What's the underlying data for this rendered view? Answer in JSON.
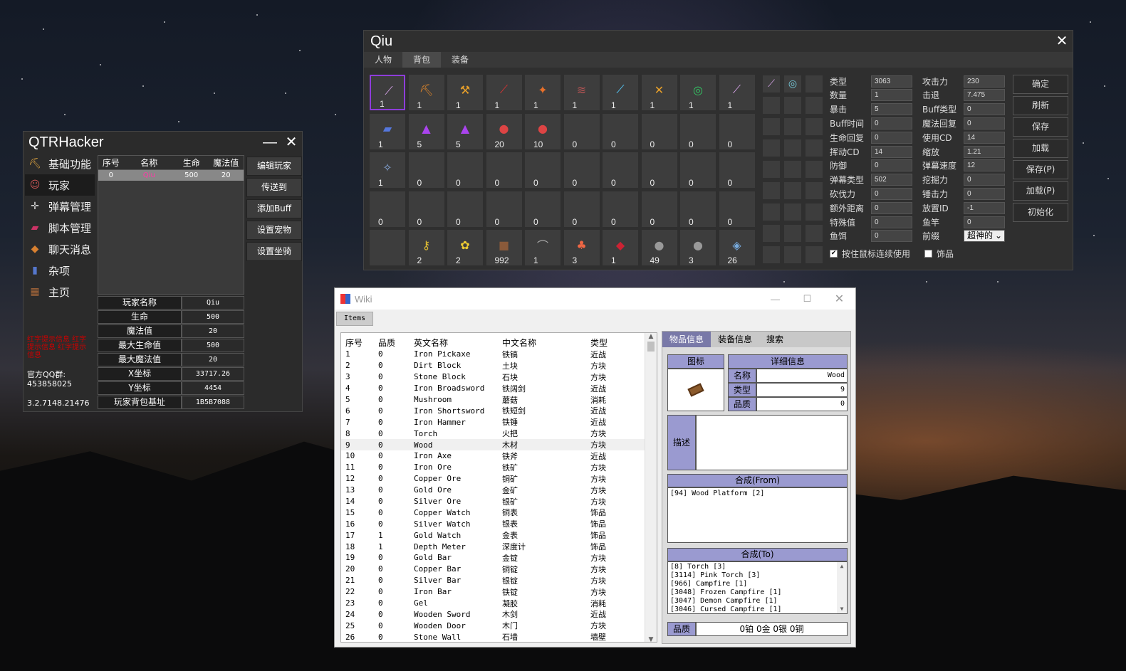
{
  "qtr": {
    "title": "QTRHacker",
    "minimize": "—",
    "close": "✕",
    "nav": [
      {
        "label": "基础功能",
        "icon": "pickaxe-icon"
      },
      {
        "label": "玩家",
        "icon": "player-icon"
      },
      {
        "label": "弹幕管理",
        "icon": "crosshair-icon"
      },
      {
        "label": "脚本管理",
        "icon": "book-icon"
      },
      {
        "label": "聊天消息",
        "icon": "chat-icon"
      },
      {
        "label": "杂项",
        "icon": "scroll-icon"
      },
      {
        "label": "主页",
        "icon": "sign-icon"
      }
    ],
    "grid": {
      "headers": [
        "序号",
        "名称",
        "生命",
        "魔法值"
      ],
      "rows": [
        [
          "0",
          "Qiu",
          "500",
          "20"
        ]
      ]
    },
    "actions": [
      "编辑玩家",
      "传送到",
      "添加Buff",
      "设置宠物",
      "设置坐骑"
    ],
    "info": [
      [
        "玩家名称",
        "Qiu"
      ],
      [
        "生命",
        "500"
      ],
      [
        "魔法值",
        "20"
      ],
      [
        "最大生命值",
        "500"
      ],
      [
        "最大魔法值",
        "20"
      ],
      [
        "X坐标",
        "33717.26"
      ],
      [
        "Y坐标",
        "4454"
      ],
      [
        "玩家背包基址",
        "1B5B7088"
      ]
    ],
    "red_text": "红字提示信息 红字提示信息 红字提示信息",
    "qq_label": "官方QQ群:",
    "qq_number": "453858025",
    "version": "3.2.7148.21476",
    "colors": {
      "bg": "#2b2b2b",
      "selected_name": "#ff3aa6",
      "warning": "#cc0000"
    }
  },
  "qiu": {
    "title": "Qiu",
    "close": "✕",
    "tabs": [
      "人物",
      "背包",
      "装备"
    ],
    "selected_tab": "背包",
    "inventory": [
      [
        "1",
        "1",
        "1",
        "1",
        "1",
        "1",
        "1",
        "1",
        "1",
        "1"
      ],
      [
        "1",
        "5",
        "5",
        "20",
        "10",
        "0",
        "0",
        "0",
        "0",
        "0"
      ],
      [
        "1",
        "0",
        "0",
        "0",
        "0",
        "0",
        "0",
        "0",
        "0",
        "0"
      ],
      [
        "0",
        "0",
        "0",
        "0",
        "0",
        "0",
        "0",
        "0",
        "0",
        "0"
      ],
      [
        "",
        "2",
        "2",
        "992",
        "1",
        "3",
        "1",
        "49",
        "3",
        "26"
      ]
    ],
    "inventory_icons": [
      [
        "sword-icon",
        "pickaxe-icon",
        "axe-icon",
        "blade-icon",
        "flame-whip-icon",
        "wings-icon",
        "beam-sword-icon",
        "spear-icon",
        "yoyo-icon",
        "sword-icon"
      ],
      [
        "scroll-icon",
        "potion-icon",
        "potion-icon",
        "heart-potion-icon",
        "heart-potion-icon",
        "",
        "",
        "",
        "",
        ""
      ],
      [
        "staff-icon",
        "",
        "",
        "",
        "",
        "",
        "",
        "",
        "",
        ""
      ],
      [
        "",
        "",
        "",
        "",
        "",
        "",
        "",
        "",
        "",
        ""
      ],
      [
        "",
        "key-icon",
        "flower-icon",
        "block-icon",
        "bat-icon",
        "mushroom-icon",
        "pot-icon",
        "ore-icon",
        "ore-icon",
        "gem-icon"
      ]
    ],
    "left_props": [
      [
        "类型",
        "3063"
      ],
      [
        "数量",
        "1"
      ],
      [
        "暴击",
        "5"
      ],
      [
        "Buff时间",
        "0"
      ],
      [
        "生命回复",
        "0"
      ],
      [
        "挥动CD",
        "14"
      ],
      [
        "防御",
        "0"
      ],
      [
        "弹幕类型",
        "502"
      ],
      [
        "砍伐力",
        "0"
      ],
      [
        "额外距离",
        "0"
      ],
      [
        "特殊值",
        "0"
      ],
      [
        "鱼饵",
        "0"
      ]
    ],
    "right_props": [
      [
        "攻击力",
        "230"
      ],
      [
        "击退",
        "7.475"
      ],
      [
        "Buff类型",
        "0"
      ],
      [
        "魔法回复",
        "0"
      ],
      [
        "使用CD",
        "14"
      ],
      [
        "缩放",
        "1.21"
      ],
      [
        "弹幕速度",
        "12"
      ],
      [
        "挖掘力",
        "0"
      ],
      [
        "锤击力",
        "0"
      ],
      [
        "放置ID",
        "-1"
      ],
      [
        "鱼竿",
        "0"
      ]
    ],
    "prefix_label": "前缀",
    "prefix_value": "超神的",
    "buttons": [
      "确定",
      "刷新",
      "保存",
      "加载",
      "保存(P)",
      "加载(P)",
      "初始化"
    ],
    "check_hold": "按住鼠标连续使用",
    "check_accessory": "饰品",
    "colors": {
      "selected_slot": "#8e3dd9"
    }
  },
  "wiki": {
    "title": "Wiki",
    "tab": "Items",
    "headers": [
      "序号",
      "品质",
      "英文名称",
      "中文名称",
      "类型"
    ],
    "rows": [
      [
        "1",
        "0",
        "Iron Pickaxe",
        "铁镐",
        "近战"
      ],
      [
        "2",
        "0",
        "Dirt Block",
        "土块",
        "方块"
      ],
      [
        "3",
        "0",
        "Stone Block",
        "石块",
        "方块"
      ],
      [
        "4",
        "0",
        "Iron Broadsword",
        "铁阔剑",
        "近战"
      ],
      [
        "5",
        "0",
        "Mushroom",
        "蘑菇",
        "消耗"
      ],
      [
        "6",
        "0",
        "Iron Shortsword",
        "铁短剑",
        "近战"
      ],
      [
        "7",
        "0",
        "Iron Hammer",
        "铁锤",
        "近战"
      ],
      [
        "8",
        "0",
        "Torch",
        "火把",
        "方块"
      ],
      [
        "9",
        "0",
        "Wood",
        "木材",
        "方块"
      ],
      [
        "10",
        "0",
        "Iron Axe",
        "铁斧",
        "近战"
      ],
      [
        "11",
        "0",
        "Iron Ore",
        "铁矿",
        "方块"
      ],
      [
        "12",
        "0",
        "Copper Ore",
        "铜矿",
        "方块"
      ],
      [
        "13",
        "0",
        "Gold Ore",
        "金矿",
        "方块"
      ],
      [
        "14",
        "0",
        "Silver Ore",
        "银矿",
        "方块"
      ],
      [
        "15",
        "0",
        "Copper Watch",
        "铜表",
        "饰品"
      ],
      [
        "16",
        "0",
        "Silver Watch",
        "银表",
        "饰品"
      ],
      [
        "17",
        "1",
        "Gold Watch",
        "金表",
        "饰品"
      ],
      [
        "18",
        "1",
        "Depth Meter",
        "深度计",
        "饰品"
      ],
      [
        "19",
        "0",
        "Gold Bar",
        "金锭",
        "方块"
      ],
      [
        "20",
        "0",
        "Copper Bar",
        "铜锭",
        "方块"
      ],
      [
        "21",
        "0",
        "Silver Bar",
        "银锭",
        "方块"
      ],
      [
        "22",
        "0",
        "Iron Bar",
        "铁锭",
        "方块"
      ],
      [
        "23",
        "0",
        "Gel",
        "凝胶",
        "消耗"
      ],
      [
        "24",
        "0",
        "Wooden Sword",
        "木剑",
        "近战"
      ],
      [
        "25",
        "0",
        "Wooden Door",
        "木门",
        "方块"
      ],
      [
        "26",
        "0",
        "Stone Wall",
        "石墙",
        "墙壁"
      ]
    ],
    "selected_row": "9",
    "right_tabs": [
      "物品信息",
      "装备信息",
      "搜索"
    ],
    "icon_header": "图标",
    "detail_header": "详细信息",
    "details": [
      [
        "名称",
        "Wood"
      ],
      [
        "类型",
        "9"
      ],
      [
        "品质",
        "0"
      ]
    ],
    "desc_label": "描述",
    "desc_value": "",
    "from_header": "合成(From)",
    "from_items": [
      "[94] Wood Platform [2]"
    ],
    "to_header": "合成(To)",
    "to_items": [
      "[8] Torch [3]",
      "[3114] Pink Torch [3]",
      "[966] Campfire [1]",
      "[3048] Frozen Campfire [1]",
      "[3047] Demon Campfire [1]",
      "[3046] Cursed Campfire [1]"
    ],
    "value_label": "品质",
    "value_text": "0铂 0金 0银 0铜",
    "colors": {
      "header_bg": "#9a9ad0",
      "tab_sel": "#7979a8"
    }
  }
}
